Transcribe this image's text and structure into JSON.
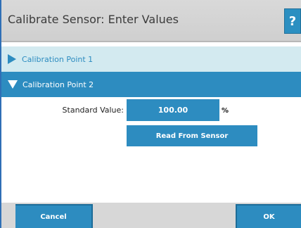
{
  "header": {
    "title": "Calibrate Sensor: Enter Values",
    "help_label": "?"
  },
  "accordion": [
    {
      "label": "Calibration Point 1",
      "expanded": false
    },
    {
      "label": "Calibration Point 2",
      "expanded": true
    }
  ],
  "form": {
    "standard_label": "Standard Value:",
    "standard_value": "100.00",
    "unit": "%",
    "read_button_label": "Read From Sensor"
  },
  "footer": {
    "cancel_label": "Cancel",
    "ok_label": "OK"
  },
  "colors": {
    "accent": "#2d8cc0",
    "collapsed_row": "#d3eaf0",
    "header_bg": "#d9d9d9"
  }
}
